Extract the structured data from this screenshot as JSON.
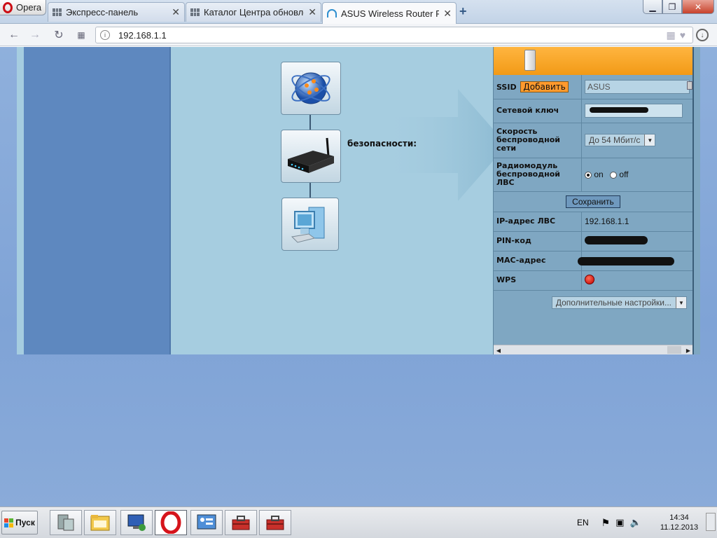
{
  "browser": {
    "menu_label": "Opera",
    "tabs": [
      {
        "title": "Экспресс-панель"
      },
      {
        "title": "Каталог Центра обновле"
      },
      {
        "title": "ASUS Wireless Router RT"
      }
    ],
    "address": "192.168.1.1"
  },
  "router": {
    "security_label": "безопасности:",
    "ssid_label": "SSID",
    "add_label": "Добавить",
    "ssid_value": "ASUS",
    "key_label": "Сетевой ключ",
    "speed_label": "Скорость беспроводной сети",
    "speed_value": "До 54 Мбит/с",
    "radio_label": "Радиомодуль беспроводной ЛВС",
    "radio_on": "on",
    "radio_off": "off",
    "radio_selected": "on",
    "save_label": "Сохранить",
    "ip_label": "IP-адрес ЛВС",
    "ip_value": "192.168.1.1",
    "pin_label": "PIN-код",
    "mac_label": "MAC-адрес",
    "wps_label": "WPS",
    "wps_status_color": "#cc0000",
    "more_settings": "Дополнительные настройки..."
  },
  "taskbar": {
    "start_label": "Пуск",
    "language": "EN",
    "time": "14:34",
    "date": "11.12.2013"
  }
}
